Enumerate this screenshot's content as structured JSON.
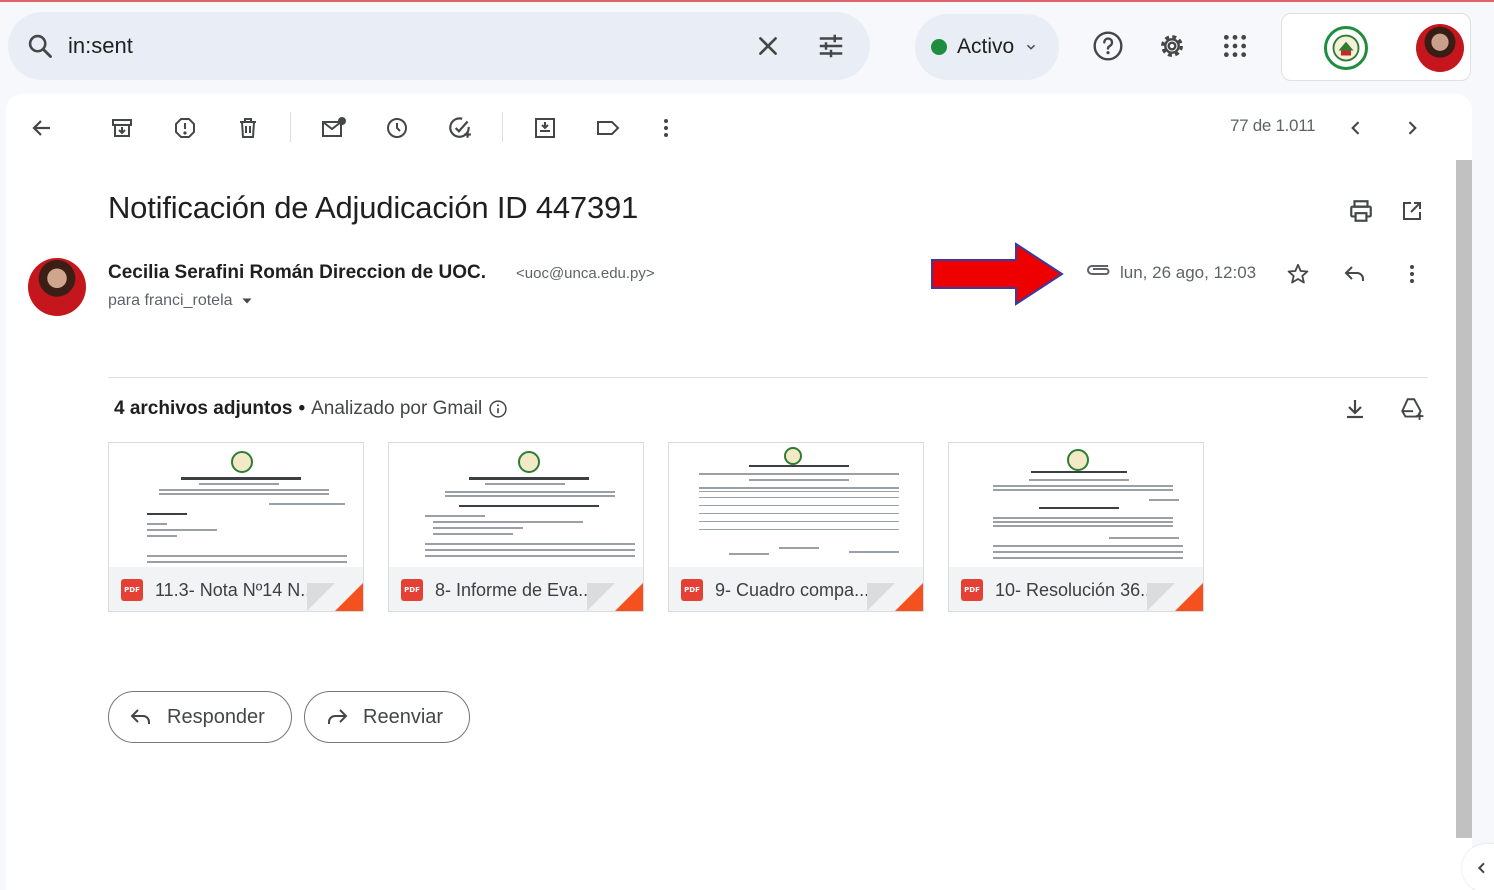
{
  "search": {
    "query": "in:sent",
    "icons": [
      "search-icon",
      "clear-icon",
      "filter-options-icon"
    ]
  },
  "header": {
    "status_label": "Activo",
    "icons": [
      "help-icon",
      "settings-icon",
      "apps-icon"
    ]
  },
  "toolbar": {
    "pager_text": "77 de 1.011"
  },
  "email": {
    "subject": "Notificación de Adjudicación ID 447391",
    "sender_name": "Cecilia Serafini Román Direccion de UOC.",
    "sender_email": "<uoc@unca.edu.py>",
    "recipient": "para franci_rotela",
    "date": "lun, 26 ago, 12:03"
  },
  "attachments": {
    "count_label": "4 archivos adjuntos",
    "separator": "•",
    "scan_label": "Analizado por Gmail",
    "files": [
      {
        "name": "11.3- Nota Nº14 N...",
        "type": "PDF"
      },
      {
        "name": "8- Informe de Eva...",
        "type": "PDF"
      },
      {
        "name": "9- Cuadro compa...",
        "type": "PDF"
      },
      {
        "name": "10- Resolución 36...",
        "type": "PDF"
      }
    ]
  },
  "actions": {
    "reply_label": "Responder",
    "forward_label": "Reenviar"
  },
  "colors": {
    "annotation_arrow": "#ee0000",
    "status_dot": "#1e8e3e",
    "pdf_badge": "#e44134"
  }
}
